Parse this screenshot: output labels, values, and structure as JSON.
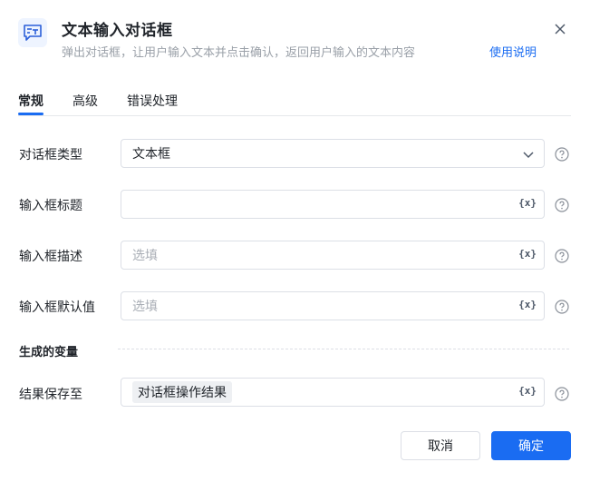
{
  "header": {
    "title": "文本输入对话框",
    "subtitle": "弹出对话框，让用户输入文本并点击确认，返回用户输入的文本内容",
    "help_link": "使用说明",
    "icon": "text-input-dialog-icon"
  },
  "tabs": [
    {
      "label": "常规",
      "active": true
    },
    {
      "label": "高级",
      "active": false
    },
    {
      "label": "错误处理",
      "active": false
    }
  ],
  "fields": {
    "dialog_type": {
      "label": "对话框类型",
      "value": "文本框"
    },
    "input_title": {
      "label": "输入框标题",
      "value": "",
      "var_button": "{x}"
    },
    "input_description": {
      "label": "输入框描述",
      "placeholder": "选填",
      "var_button": "{x}"
    },
    "input_default": {
      "label": "输入框默认值",
      "placeholder": "选填",
      "var_button": "{x}"
    }
  },
  "output_section": {
    "label": "生成的变量",
    "save_to": {
      "label": "结果保存至",
      "variable": "对话框操作结果",
      "var_button": "{x}"
    }
  },
  "footer": {
    "cancel_label": "取消",
    "confirm_label": "确定"
  },
  "colors": {
    "accent": "#1a6cf2",
    "text": "#1f2329",
    "placeholder": "#a8adb5",
    "border": "#dcdfe6"
  }
}
